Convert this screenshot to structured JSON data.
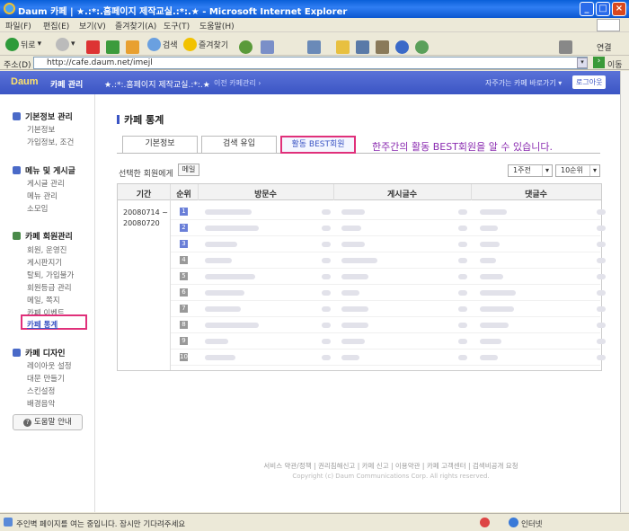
{
  "window": {
    "title": "Daum 카페 | ★.:*:.홈페이지 제작교실.:*:.★ - Microsoft Internet Explorer"
  },
  "menu": [
    "파일(F)",
    "편집(E)",
    "보기(V)",
    "즐겨찾기(A)",
    "도구(T)",
    "도움말(H)"
  ],
  "toolbar": {
    "back": "뒤로",
    "search": "검색",
    "favorites": "즐겨찾기",
    "links": "연결"
  },
  "address": {
    "label": "주소(D)",
    "url": "http://cafe.daum.net/imejl",
    "go": "이동"
  },
  "daum_header": {
    "logo": "Daum",
    "cafe_admin": "카페 관리",
    "cafe_name": "★.:*:.홈페이지 제작교실.:*:.★",
    "prev_admin": "이전 카페관리 ›",
    "shortcut": "자주가는 카페 바로가기 ▾",
    "logout": "로그아웃"
  },
  "sidebar": {
    "sections": [
      {
        "title": "기본정보 관리",
        "items": [
          "기본정보",
          "가입정보, 조건"
        ]
      },
      {
        "title": "메뉴 및 게시글",
        "items": [
          "게시글 관리",
          "메뉴 관리",
          "소모임"
        ]
      },
      {
        "title": "카페 회원관리",
        "items": [
          "회원, 운영진",
          "게시판지기",
          "탈퇴, 가입불가",
          "회원등급 관리",
          "메일, 쪽지",
          "카페 이벤트",
          "카페 통계"
        ]
      },
      {
        "title": "카페 디자인",
        "items": [
          "레이아웃 설정",
          "대문 만들기",
          "스킨설정",
          "배경음악"
        ]
      }
    ],
    "help": "도움말 안내"
  },
  "main": {
    "title": "카페 통계",
    "tabs": [
      "기본정보",
      "검색 유입",
      "활동 BEST회원"
    ],
    "annotation": "한주간의 활동 BEST회원을 알 수 있습니다.",
    "send_label": "선택한 회원에게",
    "mail_button": "메일",
    "period_select": "1주전",
    "rank_select": "10순위",
    "columns": [
      "기간",
      "순위",
      "방문수",
      "게시글수",
      "댓글수"
    ],
    "period_value": "20080714 ~ 20080720",
    "ranks": [
      "1",
      "2",
      "3",
      "4",
      "5",
      "6",
      "7",
      "8",
      "9",
      "10"
    ]
  },
  "footer": {
    "links": [
      "서비스 약관/정책",
      "권리침해신고",
      "카페 신고",
      "이용약관",
      "카페 고객센터",
      "검색비공개 요청"
    ],
    "copyright": "Copyright (c) Daum Communications Corp. All rights reserved."
  },
  "status": {
    "text": "주인벽 페이지를 여는 중입니다. 잠시만 기다려주세요",
    "zone": "인터넷"
  },
  "colors": {
    "daum_blue": "#3b55c4",
    "highlight_pink": "#e0307a",
    "annotation_purple": "#8a2bb0"
  }
}
